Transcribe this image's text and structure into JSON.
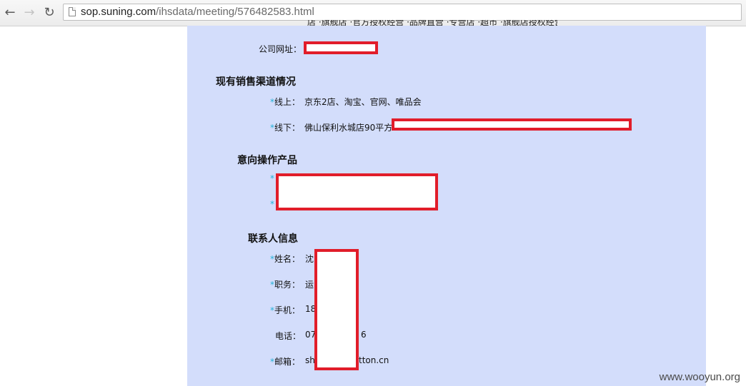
{
  "browser": {
    "url_host": "sop.suning.com",
    "url_path": "/ihsdata/meeting/576482583.html",
    "icons": {
      "back": "back-arrow-icon",
      "forward": "forward-arrow-icon",
      "reload": "reload-icon",
      "page": "page-icon"
    }
  },
  "page": {
    "cutoff_text": "店 ·旗舰店 ·官方授权经营 ·品牌直营 ·专营店 ·超市 ·旗舰店授权经营店",
    "company_url_label": "公司网址：",
    "sales_heading": "现有销售渠道情况",
    "online_label": "线上：",
    "online_value": "京东2店、淘宝、官网、唯品会",
    "offline_label": "线下：",
    "offline_value": "佛山保利水城店90平方",
    "products_heading": "意向操作产品",
    "contact_heading": "联系人信息",
    "name_label": "姓名：",
    "name_value": "沈",
    "position_label": "职务：",
    "position_value": "运",
    "mobile_label": "手机：",
    "mobile_value": "18",
    "phone_label": "电话：",
    "phone_value_start": "07",
    "phone_value_end": "6",
    "email_label": "邮箱：",
    "email_value_start": "sh",
    "email_value_end": "tton.cn",
    "star": "*"
  },
  "colors": {
    "content_bg": "#d3ddfb",
    "redaction_border": "#e11d2a",
    "star": "#27b2d8"
  },
  "watermark": "www.wooyun.org"
}
